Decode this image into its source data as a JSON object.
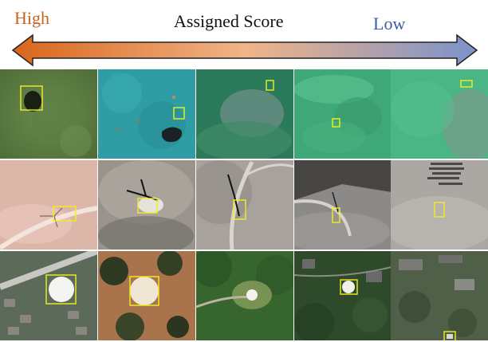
{
  "header": {
    "high_label": "High",
    "title": "Assigned Score",
    "low_label": "Low"
  },
  "colors": {
    "high": "#c8641e",
    "low": "#3a5ea0",
    "arrow_start": "#d9661c",
    "arrow_mid": "#f1b488",
    "arrow_end": "#7b92c9",
    "box": "#f2ef1e"
  },
  "arrow": {
    "direction": "both",
    "meaning": "score from high (left) to low (right)"
  },
  "grid": {
    "rows": [
      {
        "scene": "underwater",
        "columns": 5
      },
      {
        "scene": "wind-turbine-aerial",
        "columns": 5
      },
      {
        "scene": "storage-tank-aerial",
        "columns": 5
      }
    ]
  }
}
